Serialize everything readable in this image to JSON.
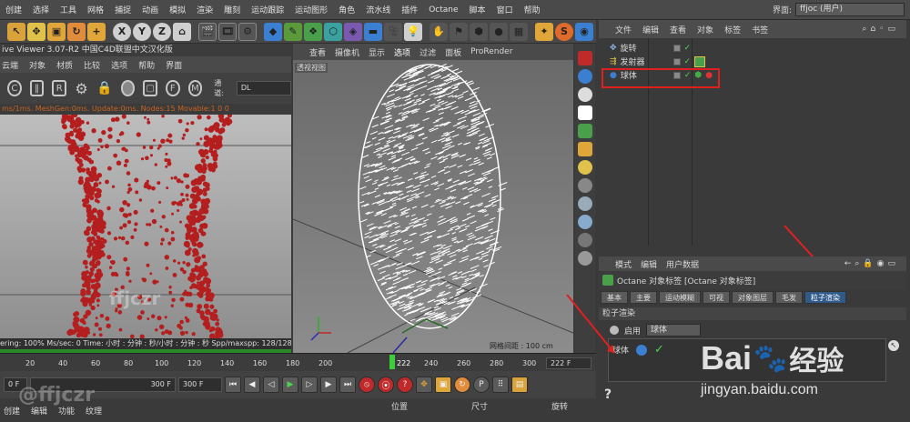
{
  "menubar": {
    "items": [
      "创建",
      "选择",
      "工具",
      "网格",
      "捕捉",
      "动画",
      "模拟",
      "渲染",
      "雕刻",
      "运动跟踪",
      "运动图形",
      "角色",
      "流水线",
      "插件",
      "Octane",
      "脚本",
      "窗口",
      "帮助"
    ],
    "layout_label": "界面:",
    "layout_value": "ffjoc (用户)"
  },
  "toolbar": {
    "axis_x": "X",
    "axis_y": "Y",
    "axis_z": "Z"
  },
  "live_viewer": {
    "title": "ive Viewer 3.07-R2 中国C4D联盟中文汉化版",
    "menu": [
      "云端",
      "对象",
      "材质",
      "比较",
      "选项",
      "帮助",
      "界面"
    ],
    "channel_label": "通道:",
    "channel_value": "DL",
    "status": "ms/1ms. MeshGen:0ms. Update:0ms. Nodes:15 Movable:1 0 0",
    "footer": "ering: 100%   Ms/sec: 0   Time: 小时 : 分钟 : 秒/小时 : 分钟 : 秒   Spp/maxspp: 128/128",
    "watermark": "ffjczr"
  },
  "viewport": {
    "menu": [
      "查看",
      "摄像机",
      "显示",
      "选项",
      "过滤",
      "面板",
      "ProRender"
    ],
    "active_menu": "选项",
    "label": "透视视图",
    "grid_text": "网格间距 : 100 cm"
  },
  "object_manager": {
    "menu": [
      "文件",
      "编辑",
      "查看",
      "对象",
      "标签",
      "书签"
    ],
    "rows": [
      {
        "name": "旋转"
      },
      {
        "name": "发射器"
      },
      {
        "name": "球体"
      }
    ]
  },
  "attributes": {
    "menu": [
      "模式",
      "编辑",
      "用户数据"
    ],
    "title": "Octane 对象标签 [Octane 对象标签]",
    "tabs": [
      "基本",
      "主要",
      "运动模糊",
      "可视",
      "对象图层",
      "毛发",
      "粒子渲染"
    ],
    "selected_tab": "粒子渲染",
    "section": "粒子渲染",
    "enable_label": "启用",
    "enable_value": "球体",
    "list_item": "球体",
    "help": "?"
  },
  "timeline": {
    "ticks": [
      "20",
      "40",
      "60",
      "80",
      "100",
      "120",
      "140",
      "160",
      "180",
      "200",
      "222",
      "240",
      "260",
      "280",
      "300"
    ],
    "current_frame": "222 F"
  },
  "transport": {
    "start_field": "0 F",
    "end_field": "300 F",
    "end_field2": "300 F"
  },
  "bottom": {
    "menu": [
      "创建",
      "编辑",
      "功能",
      "纹理"
    ],
    "coord_labels": [
      "位置",
      "尺寸",
      "旋转"
    ],
    "watermark": "@ffjczr"
  },
  "watermark": {
    "brand": "Bai",
    "brand_cn": "经验",
    "url": "jingyan.baidu.com"
  },
  "colors": {
    "accent_red": "#e02020",
    "particle_red": "#b41e1e",
    "selected_tab": "#2f5a8a",
    "progress_green": "#2a8a2a"
  }
}
